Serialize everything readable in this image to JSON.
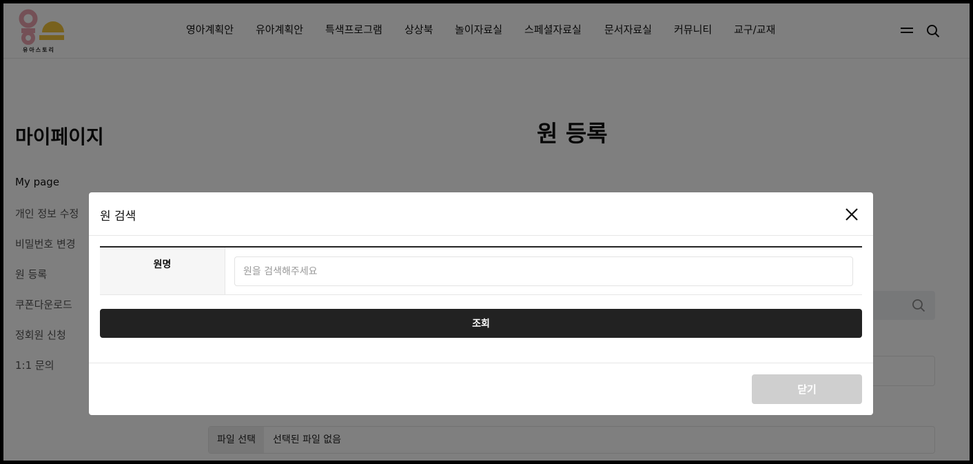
{
  "header": {
    "logo_text": "유아스토리",
    "nav": [
      "영아계획안",
      "유아계획안",
      "특색프로그램",
      "상상북",
      "놀이자료실",
      "스페셜자료실",
      "문서자료실",
      "커뮤니티",
      "교구/교재"
    ]
  },
  "sidebar": {
    "title": "마이페이지",
    "items": [
      "My page",
      "개인 정보 수정",
      "비밀번호 변경",
      "원 등록",
      "쿠폰다운로드",
      "정회원 신청",
      "1:1 문의"
    ]
  },
  "page": {
    "title": "원 등록",
    "file_button": "파일 선택",
    "file_status": "선택된 파일 없음"
  },
  "modal": {
    "title": "원 검색",
    "field_label": "원명",
    "field_placeholder": "원을 검색해주세요",
    "field_value": "",
    "search_label": "조회",
    "close_label": "닫기"
  },
  "colors": {
    "logo_pink": "#e8a0ad",
    "logo_yellow": "#f0c23a",
    "dark": "#222222",
    "overlay": "rgba(0,0,0,0.5)"
  }
}
